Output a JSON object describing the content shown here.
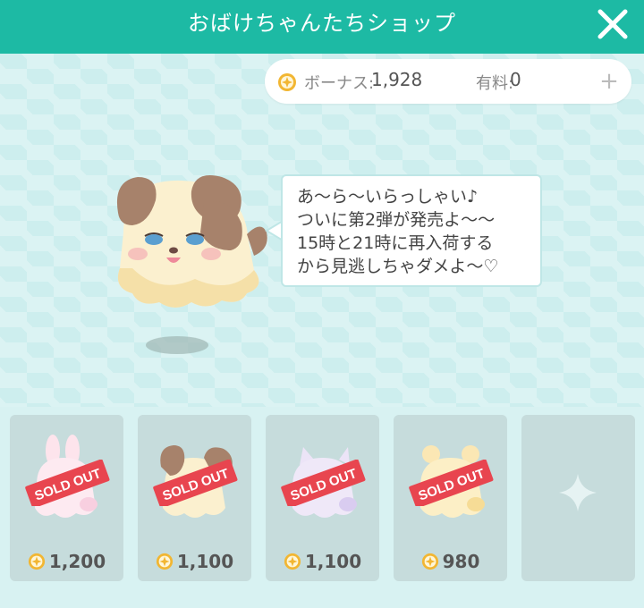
{
  "header": {
    "title": "おばけちゃんたちショップ"
  },
  "currency": {
    "bonus_label": "ボーナス:",
    "bonus_value": "1,928",
    "paid_label": "有料:",
    "paid_value": "0",
    "plus": "+"
  },
  "speech": {
    "text": "あ〜ら〜いらっしゃい♪\nついに第2弾が発売よ〜〜\n15時と21時に再入荷する\nから見逃しちゃダメよ〜♡"
  },
  "shop": {
    "items": [
      {
        "badge": "SOLD OUT",
        "price": "1,200",
        "icon": "bunny-ghost-icon"
      },
      {
        "badge": "SOLD OUT",
        "price": "1,100",
        "icon": "puppy-ghost-icon"
      },
      {
        "badge": "SOLD OUT",
        "price": "1,100",
        "icon": "kitty-ghost-icon"
      },
      {
        "badge": "SOLD OUT",
        "price": "980",
        "icon": "bear-ghost-icon"
      }
    ],
    "empty_slot_icon": "sparkle-icon"
  },
  "colors": {
    "header": "#1dbaa4",
    "stage": "#cdeeee",
    "shelf": "#d8f2f2",
    "card": "#c6dcdc",
    "sold_out_badge": "#e8454f",
    "coin": "#f2b632"
  }
}
